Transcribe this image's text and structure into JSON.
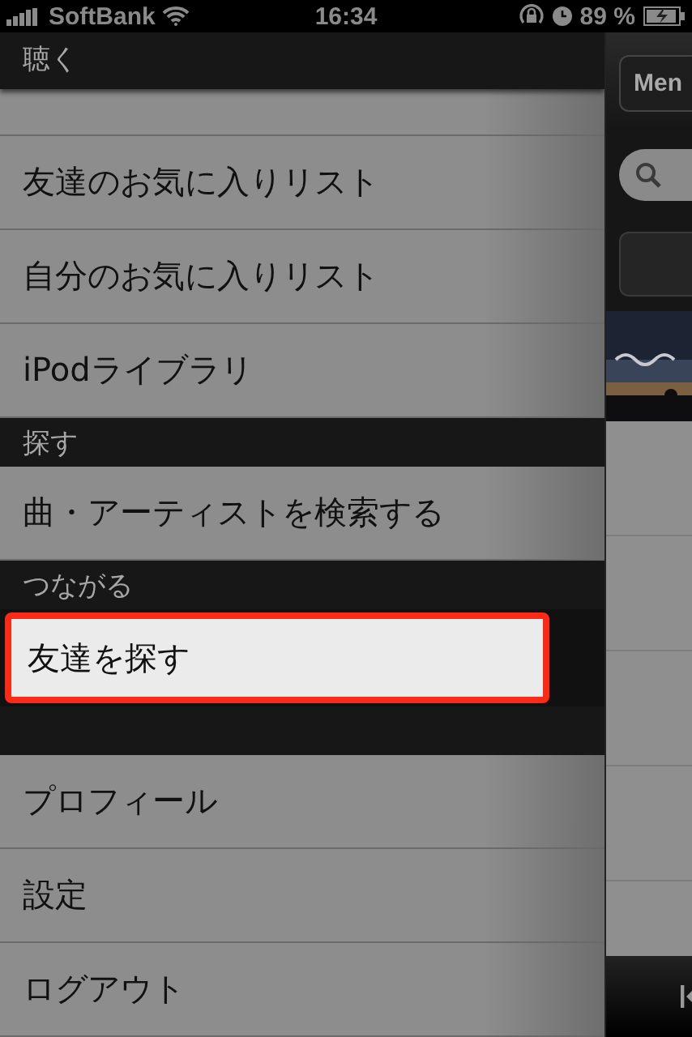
{
  "status_bar": {
    "carrier": "SoftBank",
    "time": "16:34",
    "battery": "89 %"
  },
  "menu": {
    "sections": [
      {
        "title": "聴く",
        "items": [
          {
            "label": "友達のお気に入りリスト",
            "selected": false
          },
          {
            "label": "自分のお気に入りリスト",
            "selected": false
          },
          {
            "label": "iPodライブラリ",
            "selected": false
          }
        ]
      },
      {
        "title": "探す",
        "items": [
          {
            "label": "曲・アーティストを検索する",
            "selected": false
          }
        ]
      },
      {
        "title": "つながる",
        "items": [
          {
            "label": "友達を探す",
            "selected": true
          }
        ]
      },
      {
        "items": [
          {
            "label": "プロフィール",
            "selected": false
          },
          {
            "label": "設定",
            "selected": false
          },
          {
            "label": "ログアウト",
            "selected": false
          }
        ]
      }
    ]
  },
  "main": {
    "menu_button": "Men"
  }
}
